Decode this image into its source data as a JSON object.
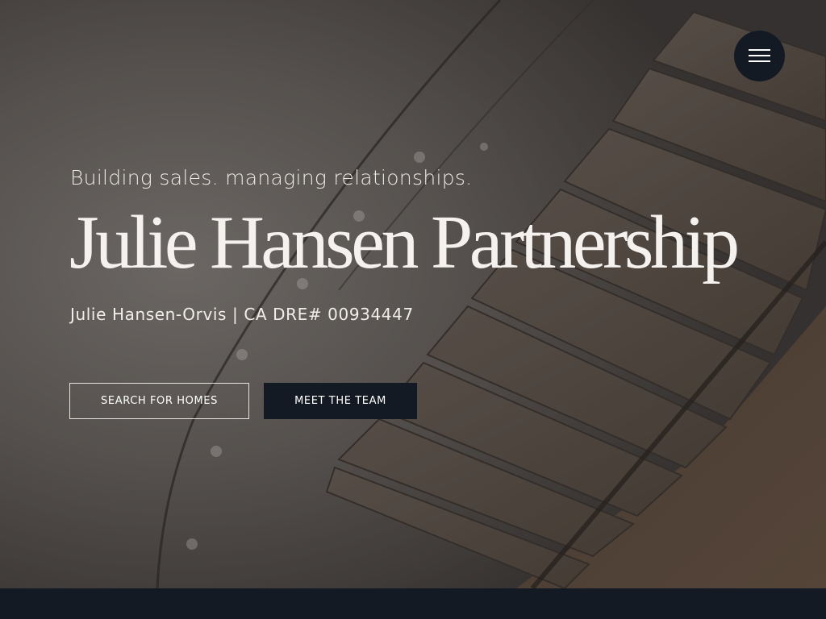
{
  "header": {
    "menu_icon": "hamburger-menu-icon"
  },
  "hero": {
    "tagline": "Building sales. managing relationships.",
    "title": "Julie Hansen Partnership",
    "subtitle": "Julie Hansen-Orvis | CA DRE# 00934447",
    "background_image": "spiral-staircase-photo",
    "buttons": {
      "search_label": "SEARCH FOR HOMES",
      "team_label": "MEET THE TEAM"
    }
  },
  "colors": {
    "navy": "#131a23",
    "overlay_text": "#f4f1ee"
  }
}
